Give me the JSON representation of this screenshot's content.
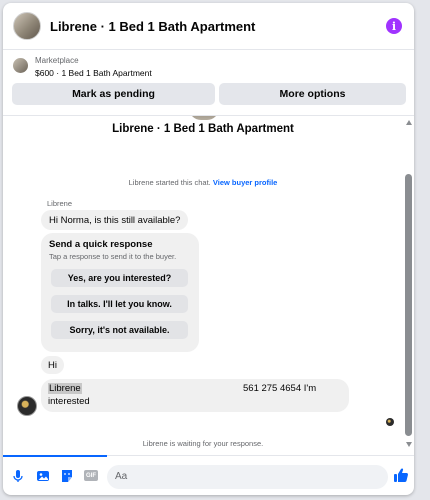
{
  "header": {
    "title": "Librene · 1 Bed 1 Bath Apartment",
    "info_glyph": "i"
  },
  "marketplace": {
    "label": "Marketplace",
    "listing": "$600 · 1 Bed 1 Bath Apartment",
    "pending_button": "Mark as pending",
    "more_button": "More options"
  },
  "chat": {
    "title": "Librene · 1 Bed 1 Bath Apartment",
    "started_text": "Librene started this chat.",
    "view_profile_link": "View buyer profile",
    "sender_name": "Librene",
    "message_1": "Hi Norma, is this still available?",
    "quick_response": {
      "title": "Send a quick response",
      "subtitle": "Tap a response to send it to the buyer.",
      "options": [
        "Yes, are you interested?",
        "In talks. I'll let you know.",
        "Sorry, it's not available."
      ]
    },
    "message_2": "Hi",
    "message_3": {
      "name": "Librene",
      "phone": "561 275 4654 I'm",
      "continuation": "interested"
    },
    "waiting_text": "Librene is waiting for your response."
  },
  "composer": {
    "placeholder": "Aa",
    "gif_label": "GIF"
  },
  "colors": {
    "accent": "#0866ff",
    "info": "#a033ff",
    "bubble": "#f0f0f0"
  },
  "icons": [
    "info-icon",
    "mic-icon",
    "photo-icon",
    "sticker-icon",
    "gif-icon",
    "emoji-icon",
    "like-icon"
  ]
}
